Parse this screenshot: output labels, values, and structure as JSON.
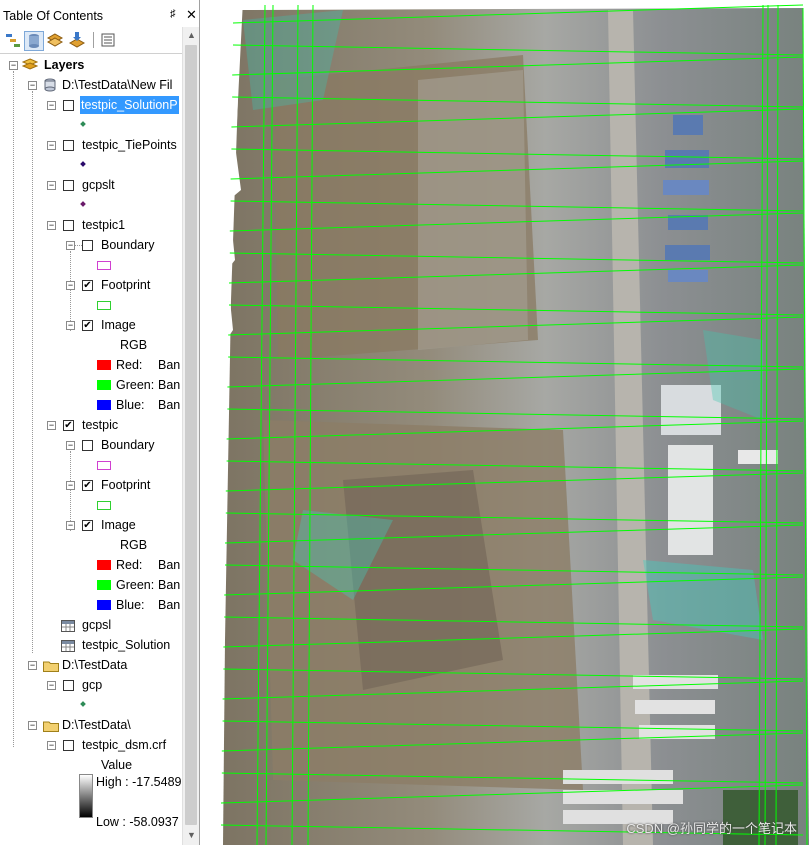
{
  "toc": {
    "title": "Table Of Contents",
    "pin": "♯",
    "close": "✕",
    "toolbar": [
      {
        "icon": "list-by-drawing-order-icon"
      },
      {
        "icon": "list-by-source-icon"
      },
      {
        "icon": "list-by-visibility-icon"
      },
      {
        "icon": "list-by-selection-icon"
      },
      {
        "icon": "options-icon"
      }
    ],
    "root_label": "Layers",
    "groups": {
      "gdb": {
        "label": "D:\\TestData\\New Fil"
      },
      "testdata": {
        "label": "D:\\TestData"
      },
      "testdata2": {
        "label": "D:\\TestData\\"
      }
    },
    "layers": {
      "solution_points": {
        "label": "testpic_SolutionP",
        "symbol_color": "#2e8b57"
      },
      "tie_points": {
        "label": "testpic_TiePoints",
        "symbol_color": "#2a0a6b"
      },
      "gcpslt": {
        "label": "gcpslt",
        "symbol_color": "#6a1a6a"
      },
      "testpic1": {
        "label": "testpic1"
      },
      "testpic": {
        "label": "testpic"
      },
      "gcpsl": {
        "label": "gcpsl"
      },
      "testpic_solution": {
        "label": "testpic_Solution"
      },
      "gcp": {
        "label": "gcp",
        "symbol_color": "#2e8b57"
      },
      "dsm": {
        "label": "testpic_dsm.crf"
      }
    },
    "sublayers": {
      "boundary": {
        "label": "Boundary",
        "color": "#d040d0"
      },
      "footprint": {
        "label": "Footprint",
        "color": "#30d030"
      },
      "image": {
        "label": "Image"
      },
      "rgb": "RGB",
      "red": {
        "label": "Red:",
        "value": "Ban",
        "color": "#ff0000"
      },
      "green": {
        "label": "Green:",
        "value": "Ban",
        "color": "#00ff00"
      },
      "blue": {
        "label": "Blue:",
        "value": "Ban",
        "color": "#0000ff"
      }
    },
    "dsm_legend": {
      "value_label": "Value",
      "high": "High : -17.5489",
      "low": "Low : -58.0937"
    }
  },
  "map": {
    "watermark": "CSDN @孙同学的一个笔记本",
    "footprint_color": "#00ff00"
  }
}
